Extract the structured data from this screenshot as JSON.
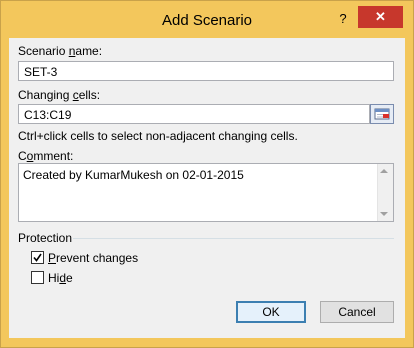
{
  "window": {
    "title": "Add Scenario",
    "help_glyph": "?",
    "close_glyph": "✕"
  },
  "scenario_name": {
    "label_pre": "Scenario ",
    "label_accel": "n",
    "label_post": "ame:",
    "value": "SET-3"
  },
  "changing_cells": {
    "label_pre": "Changing ",
    "label_accel": "c",
    "label_post": "ells:",
    "value": "C13:C19",
    "collapse_icon": "range-collapse-icon"
  },
  "hint": "Ctrl+click cells to select non-adjacent changing cells.",
  "comment": {
    "label_pre": "C",
    "label_accel": "o",
    "label_post": "mment:",
    "value": "Created by KumarMukesh on 02-01-2015"
  },
  "protection": {
    "group_label": "Protection",
    "prevent_changes": {
      "accel": "P",
      "rest": "revent changes",
      "checked": true
    },
    "hide": {
      "pre": "Hi",
      "accel": "d",
      "post": "e",
      "checked": false
    }
  },
  "buttons": {
    "ok": "OK",
    "cancel": "Cancel"
  },
  "colors": {
    "titlebar": "#f3c75c",
    "close": "#c7372c",
    "client": "#f0f0f0"
  }
}
